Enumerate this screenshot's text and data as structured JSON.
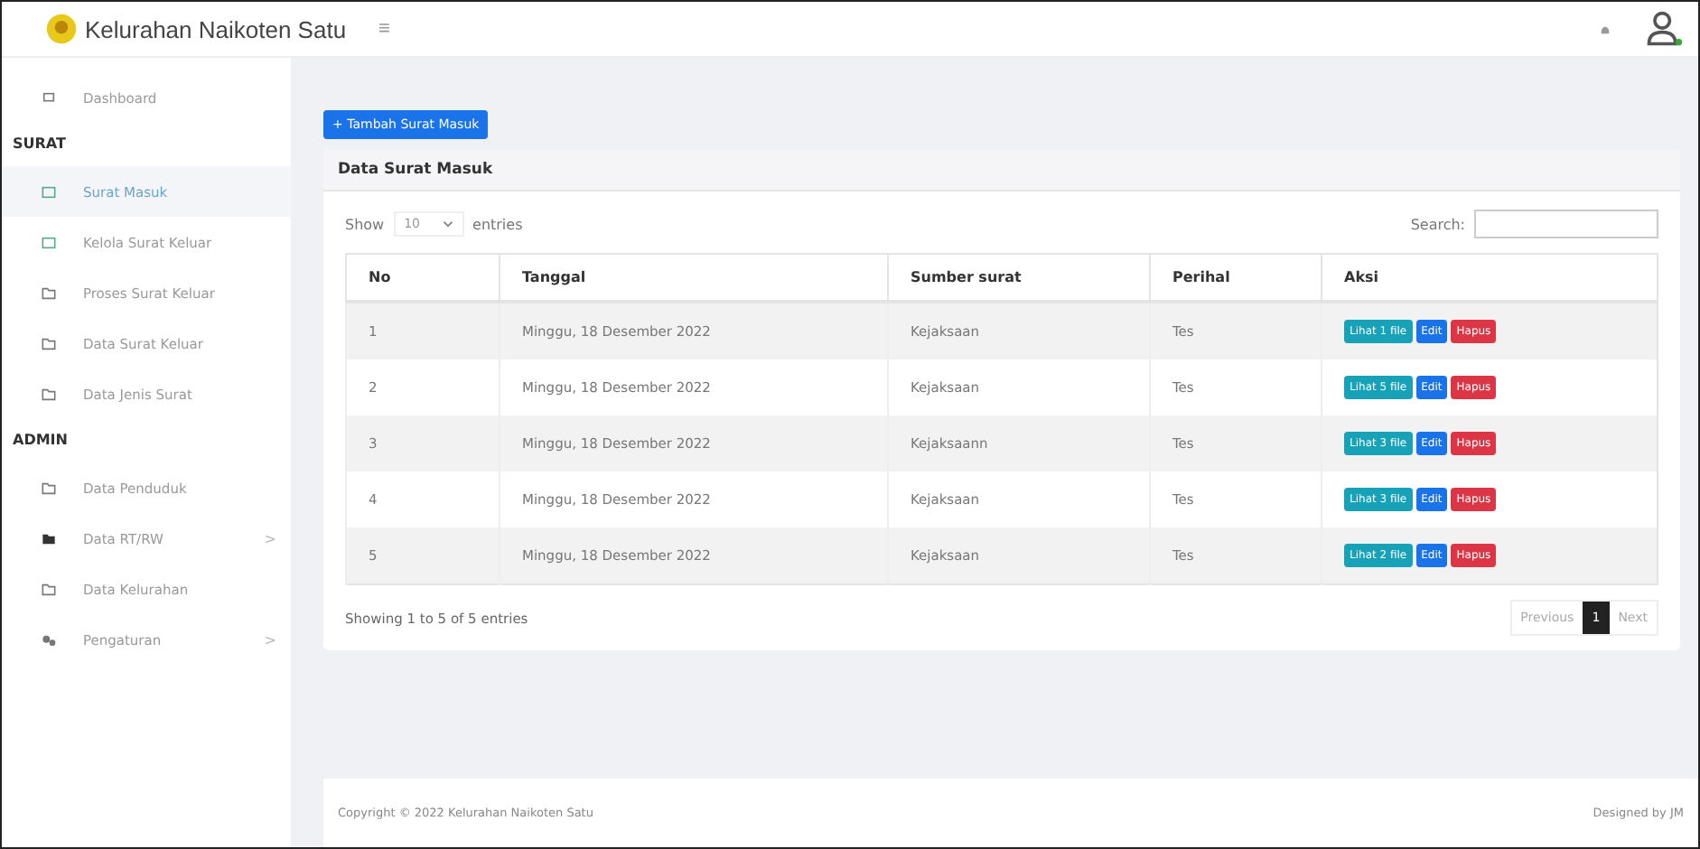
{
  "header": {
    "title": "Kelurahan Naikoten Satu",
    "menu_glyph": "≡"
  },
  "sidebar": {
    "items": [
      {
        "kind": "link",
        "label": "Dashboard",
        "selected": false
      },
      {
        "kind": "heading",
        "label": "SURAT"
      },
      {
        "kind": "link",
        "label": "Surat Masuk",
        "selected": true
      },
      {
        "kind": "link",
        "label": "Kelola Surat Keluar",
        "selected": false
      },
      {
        "kind": "link",
        "label": "Proses Surat Keluar",
        "selected": false
      },
      {
        "kind": "link",
        "label": "Data Surat Keluar",
        "selected": false
      },
      {
        "kind": "link",
        "label": "Data Jenis Surat",
        "selected": false
      },
      {
        "kind": "heading",
        "label": "ADMIN"
      },
      {
        "kind": "link",
        "label": "Data Penduduk",
        "selected": false
      },
      {
        "kind": "link",
        "label": "Data RT/RW",
        "selected": false,
        "chevron": ">"
      },
      {
        "kind": "link",
        "label": "Data Kelurahan",
        "selected": false
      },
      {
        "kind": "link",
        "label": "Pengaturan",
        "selected": false,
        "chevron": ">"
      }
    ]
  },
  "add_button": "+ Tambah Surat Masuk",
  "card": {
    "title": "Data Surat Masuk",
    "show_label": "Show",
    "page_size": "10",
    "entries_label": "entries",
    "search_label": "Search:",
    "table": {
      "columns": [
        "No",
        "Tanggal",
        "Sumber surat",
        "Perihal",
        "Aksi"
      ],
      "rows": [
        {
          "no": "1",
          "tanggal": "Minggu, 18 Desember 2022",
          "sumber": "Kejaksaan",
          "perihal": "Tes",
          "actions": [
            "Lihat 1 file",
            "Edit",
            "Hapus"
          ]
        },
        {
          "no": "2",
          "tanggal": "Minggu, 18 Desember 2022",
          "sumber": "Kejaksaan",
          "perihal": "Tes",
          "actions": [
            "Lihat 5 file",
            "Edit",
            "Hapus"
          ]
        },
        {
          "no": "3",
          "tanggal": "Minggu, 18 Desember 2022",
          "sumber": "Kejaksaann",
          "perihal": "Tes",
          "actions": [
            "Lihat 3 file",
            "Edit",
            "Hapus"
          ]
        },
        {
          "no": "4",
          "tanggal": "Minggu, 18 Desember 2022",
          "sumber": "Kejaksaan",
          "perihal": "Tes",
          "actions": [
            "Lihat 3 file",
            "Edit",
            "Hapus"
          ]
        },
        {
          "no": "5",
          "tanggal": "Minggu, 18 Desember 2022",
          "sumber": "Kejaksaan",
          "perihal": "Tes",
          "actions": [
            "Lihat 2 file",
            "Edit",
            "Hapus"
          ]
        }
      ]
    },
    "info": "Showing 1 to 5 of 5 entries",
    "pagination": [
      {
        "label": "Previous",
        "selected": false
      },
      {
        "label": "1",
        "selected": true
      },
      {
        "label": "Next",
        "selected": false
      }
    ]
  },
  "footer": {
    "copyright": "Copyright © 2022 Kelurahan Naikoten Satu",
    "credit": "Designed by JM"
  }
}
